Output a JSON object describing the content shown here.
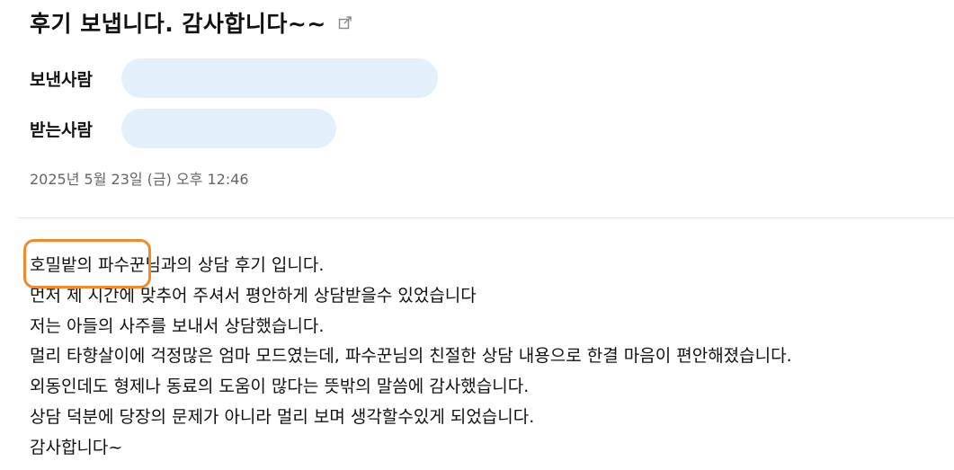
{
  "subject": "후기 보냅니다. 감사합니다~~",
  "popout_icon": "external-link-icon",
  "sender": {
    "label": "보낸사람"
  },
  "receiver": {
    "label": "받는사람"
  },
  "date": "2025년 5월 23일 (금) 오후 12:46",
  "colors": {
    "pill": "#e3f0fc",
    "highlight": "#f08a2c",
    "date": "#666666"
  },
  "body": {
    "line1_highlight": "호밀밭의 파수꾼",
    "line1_rest": "님과의 상담 후기 입니다.",
    "lines": [
      "먼저 제 시간에 맞추어 주셔서 평안하게 상담받을수 있었습니다",
      "저는 아들의 사주를 보내서 상담했습니다.",
      "멀리 타향살이에 걱정많은 엄마 모드였는데, 파수꾼님의 친절한 상담 내용으로 한결 마음이 편안해졌습니다.",
      "외동인데도 형제나 동료의 도움이 많다는 뜻밖의 말씀에 감사했습니다.",
      "상담 덕분에 당장의 문제가 아니라 멀리 보며 생각할수있게 되었습니다.",
      "감사합니다~"
    ]
  }
}
